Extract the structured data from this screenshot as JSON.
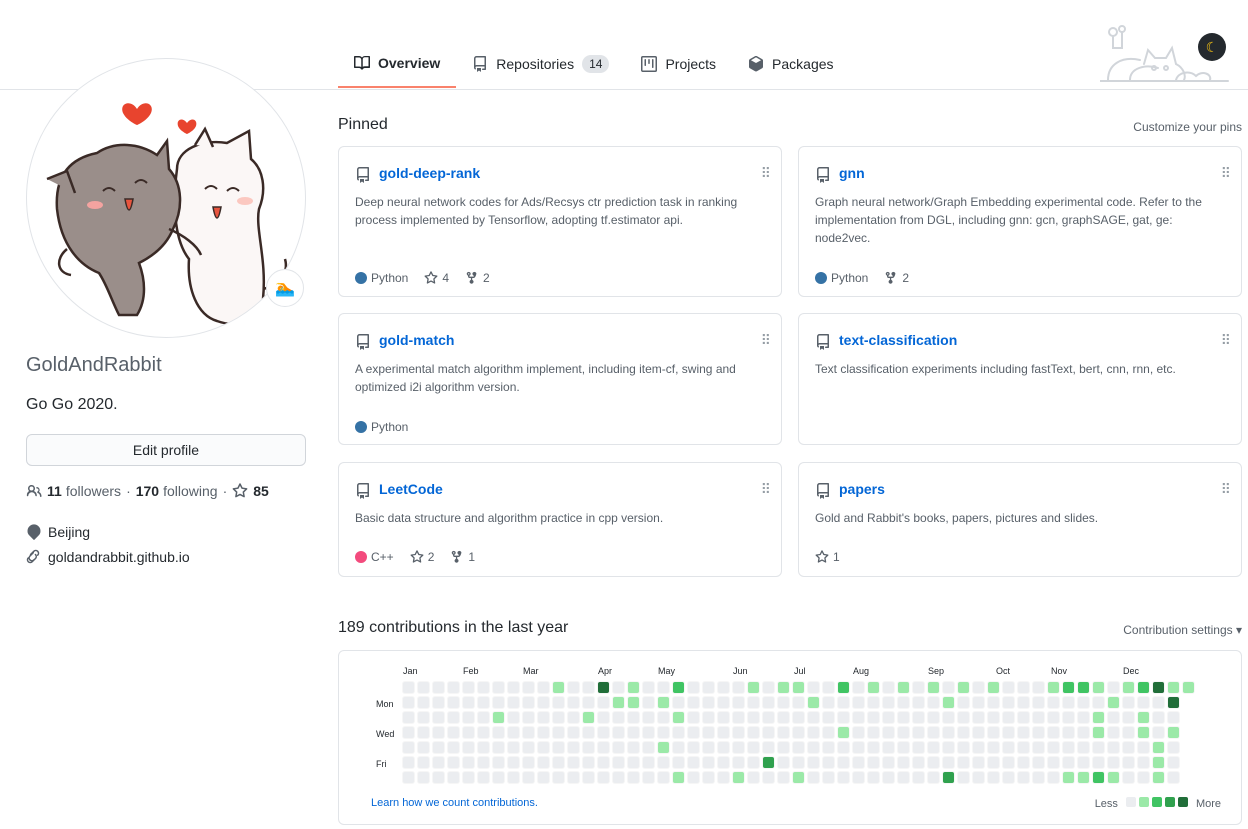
{
  "tabs": [
    {
      "label": "Overview",
      "icon": "book-icon",
      "active": true
    },
    {
      "label": "Repositories",
      "icon": "repo-icon",
      "count": "14"
    },
    {
      "label": "Projects",
      "icon": "project-icon"
    },
    {
      "label": "Packages",
      "icon": "package-icon"
    }
  ],
  "profile": {
    "username": "GoldAndRabbit",
    "bio": "Go Go 2020.",
    "edit_label": "Edit profile",
    "followers_count": "11",
    "followers_label": "followers",
    "following_count": "170",
    "following_label": "following",
    "stars_count": "85",
    "location": "Beijing",
    "website": "goldandrabbit.github.io",
    "status_emoji": "🏊"
  },
  "pinned": {
    "title": "Pinned",
    "customize": "Customize your pins",
    "cards": [
      {
        "name": "gold-deep-rank",
        "desc": "Deep neural network codes for Ads/Recsys ctr prediction task in ranking process implemented by Tensorflow, adopting tf.estimator api.",
        "lang": "Python",
        "lang_color": "#3572A5",
        "stars": "4",
        "forks": "2"
      },
      {
        "name": "gnn",
        "desc": "Graph neural network/Graph Embedding experimental code. Refer to the implementation from DGL, including gnn: gcn, graphSAGE, gat, ge: node2vec.",
        "lang": "Python",
        "lang_color": "#3572A5",
        "forks": "2"
      },
      {
        "name": "gold-match",
        "desc": "A experimental match algorithm implement, including item-cf, swing and optimized i2i algorithm version.",
        "lang": "Python",
        "lang_color": "#3572A5"
      },
      {
        "name": "text-classification",
        "desc": "Text classification experiments including fastText, bert, cnn, rnn, etc."
      },
      {
        "name": "LeetCode",
        "desc": "Basic data structure and algorithm practice in cpp version.",
        "lang": "C++",
        "lang_color": "#f34b7d",
        "stars": "2",
        "forks": "1"
      },
      {
        "name": "papers",
        "desc": "Gold and Rabbit's books, papers, pictures and slides.",
        "stars": "1"
      }
    ]
  },
  "contributions": {
    "title": "189 contributions in the last year",
    "settings": "Contribution settings ▾",
    "months": [
      "Jan",
      "Feb",
      "Mar",
      "Apr",
      "May",
      "Jun",
      "Jul",
      "Aug",
      "Sep",
      "Oct",
      "Nov",
      "Dec"
    ],
    "days": [
      "Mon",
      "Wed",
      "Fri"
    ],
    "learn": "Learn how we count contributions.",
    "less": "Less",
    "more": "More",
    "colors": [
      "#ebedf0",
      "#9be9a8",
      "#40c463",
      "#30a14e",
      "#216e39"
    ]
  }
}
